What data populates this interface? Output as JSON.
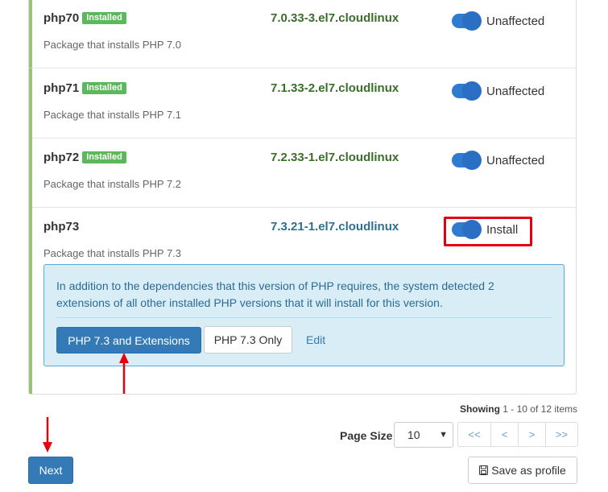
{
  "packages": [
    {
      "name": "php70",
      "badge": "Installed",
      "description": "Package that installs PHP 7.0",
      "version": "7.0.33-3.el7.cloudlinux",
      "toggle_label": "Unaffected"
    },
    {
      "name": "php71",
      "badge": "Installed",
      "description": "Package that installs PHP 7.1",
      "version": "7.1.33-2.el7.cloudlinux",
      "toggle_label": "Unaffected"
    },
    {
      "name": "php72",
      "badge": "Installed",
      "description": "Package that installs PHP 7.2",
      "version": "7.2.33-1.el7.cloudlinux",
      "toggle_label": "Unaffected"
    },
    {
      "name": "php73",
      "badge": "",
      "description": "Package that installs PHP 7.3",
      "version": "7.3.21-1.el7.cloudlinux",
      "toggle_label": "Install"
    }
  ],
  "info": {
    "message": "In addition to the dependencies that this version of PHP requires, the system detected 2 extensions of all other installed PHP versions that it will install for this version.",
    "primary_button": "PHP 7.3 and Extensions",
    "secondary_button": "PHP 7.3 Only",
    "edit_link": "Edit"
  },
  "pagination": {
    "showing_label": "Showing",
    "showing_range": "1 - 10 of 12 items",
    "page_size_label": "Page Size",
    "page_size_value": "10",
    "first": "<<",
    "prev": "<",
    "next": ">",
    "last": ">>"
  },
  "footer": {
    "next_button": "Next",
    "save_button": "Save as profile"
  },
  "colors": {
    "accent": "#337ab7",
    "installed_badge": "#5cb85c",
    "highlight": "#e3000f",
    "info_bg": "#d9edf7"
  }
}
